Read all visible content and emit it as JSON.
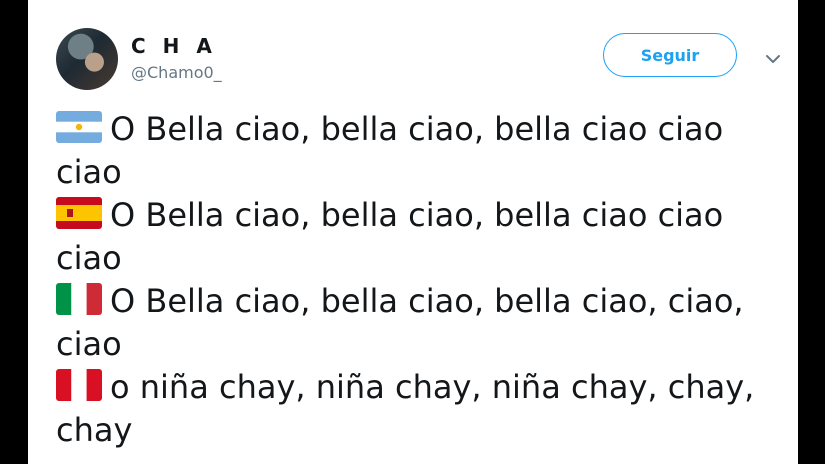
{
  "user": {
    "display_name": "C H A",
    "handle": "@Chamo0_"
  },
  "actions": {
    "follow_label": "Seguir"
  },
  "icons": {
    "avatar": "user-avatar",
    "menu": "chevron-down-icon"
  },
  "colors": {
    "accent": "#1da1f2",
    "text": "#14171a",
    "muted": "#657786"
  },
  "tweet": {
    "lines": [
      {
        "flag": "argentina-flag-icon",
        "text": "O Bella ciao, bella ciao, bella ciao ciao",
        "wrap": "ciao"
      },
      {
        "flag": "spain-flag-icon",
        "text": "O Bella ciao, bella ciao, bella ciao ciao",
        "wrap": "ciao"
      },
      {
        "flag": "italy-flag-icon",
        "text": "O Bella ciao, bella ciao, bella ciao, ciao,",
        "wrap": "ciao"
      },
      {
        "flag": "peru-flag-icon",
        "text": "o niña chay, niña chay, niña chay, chay,",
        "wrap": "chay"
      }
    ]
  }
}
